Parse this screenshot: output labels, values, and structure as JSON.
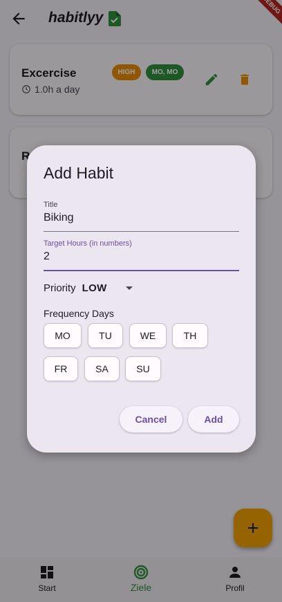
{
  "appbar": {
    "title": "habitlyy",
    "debug_banner": "DEBUG"
  },
  "habits": [
    {
      "name": "Excercise",
      "duration": "1.0h a day",
      "priority_badge": "HIGH",
      "days_badge": "MO, MO"
    },
    {
      "name_partial": "R"
    }
  ],
  "fab": {
    "icon": "plus-icon"
  },
  "bottom_nav": {
    "items": [
      {
        "label": "Start",
        "icon": "dashboard-icon"
      },
      {
        "label": "Ziele",
        "icon": "target-icon",
        "active": true
      },
      {
        "label": "Profil",
        "icon": "person-icon"
      }
    ]
  },
  "dialog": {
    "title": "Add Habit",
    "title_field": {
      "label": "Title",
      "value": "Biking"
    },
    "hours_field": {
      "label": "Target Hours (in numbers)",
      "value": "2"
    },
    "priority": {
      "label": "Priority",
      "value": "LOW"
    },
    "frequency": {
      "label": "Frequency Days",
      "days": [
        "MO",
        "TU",
        "WE",
        "TH",
        "FR",
        "SA",
        "SU"
      ]
    },
    "cancel_label": "Cancel",
    "add_label": "Add"
  },
  "colors": {
    "accent": "#6750a4",
    "high_badge": "#e88b00",
    "days_badge": "#2f8f3d",
    "fab": "#f3a103",
    "active_nav": "#2f8f3d"
  }
}
